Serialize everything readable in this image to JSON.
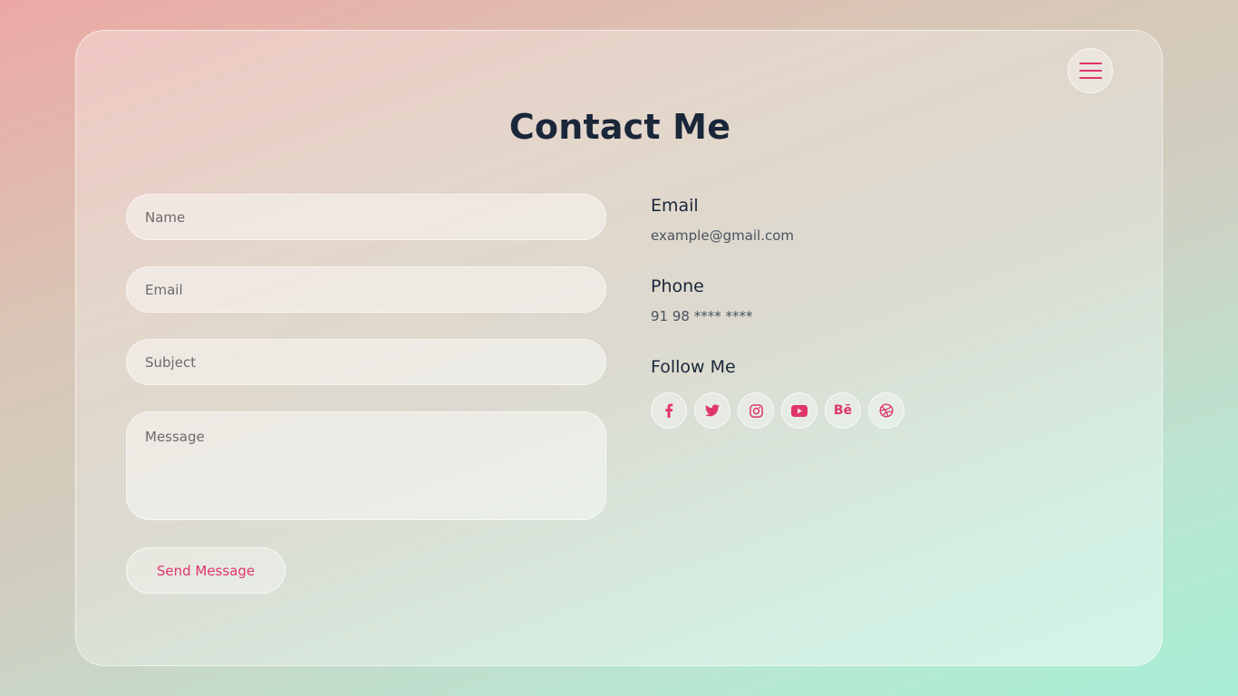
{
  "page": {
    "title": "Contact Me"
  },
  "form": {
    "name_placeholder": "Name",
    "email_placeholder": "Email",
    "subject_placeholder": "Subject",
    "message_placeholder": "Message",
    "submit_label": "Send Message"
  },
  "info": {
    "email_heading": "Email",
    "email_value": "example@gmail.com",
    "phone_heading": "Phone",
    "phone_value": "91 98 **** ****",
    "follow_heading": "Follow Me"
  },
  "socials": [
    {
      "icon": "facebook-icon"
    },
    {
      "icon": "twitter-icon"
    },
    {
      "icon": "instagram-icon"
    },
    {
      "icon": "youtube-icon"
    },
    {
      "icon": "behance-icon",
      "text": "Bē"
    },
    {
      "icon": "dribbble-icon"
    }
  ],
  "colors": {
    "accent": "#e0356c",
    "heading": "#1a2639",
    "text": "#4a5260"
  }
}
